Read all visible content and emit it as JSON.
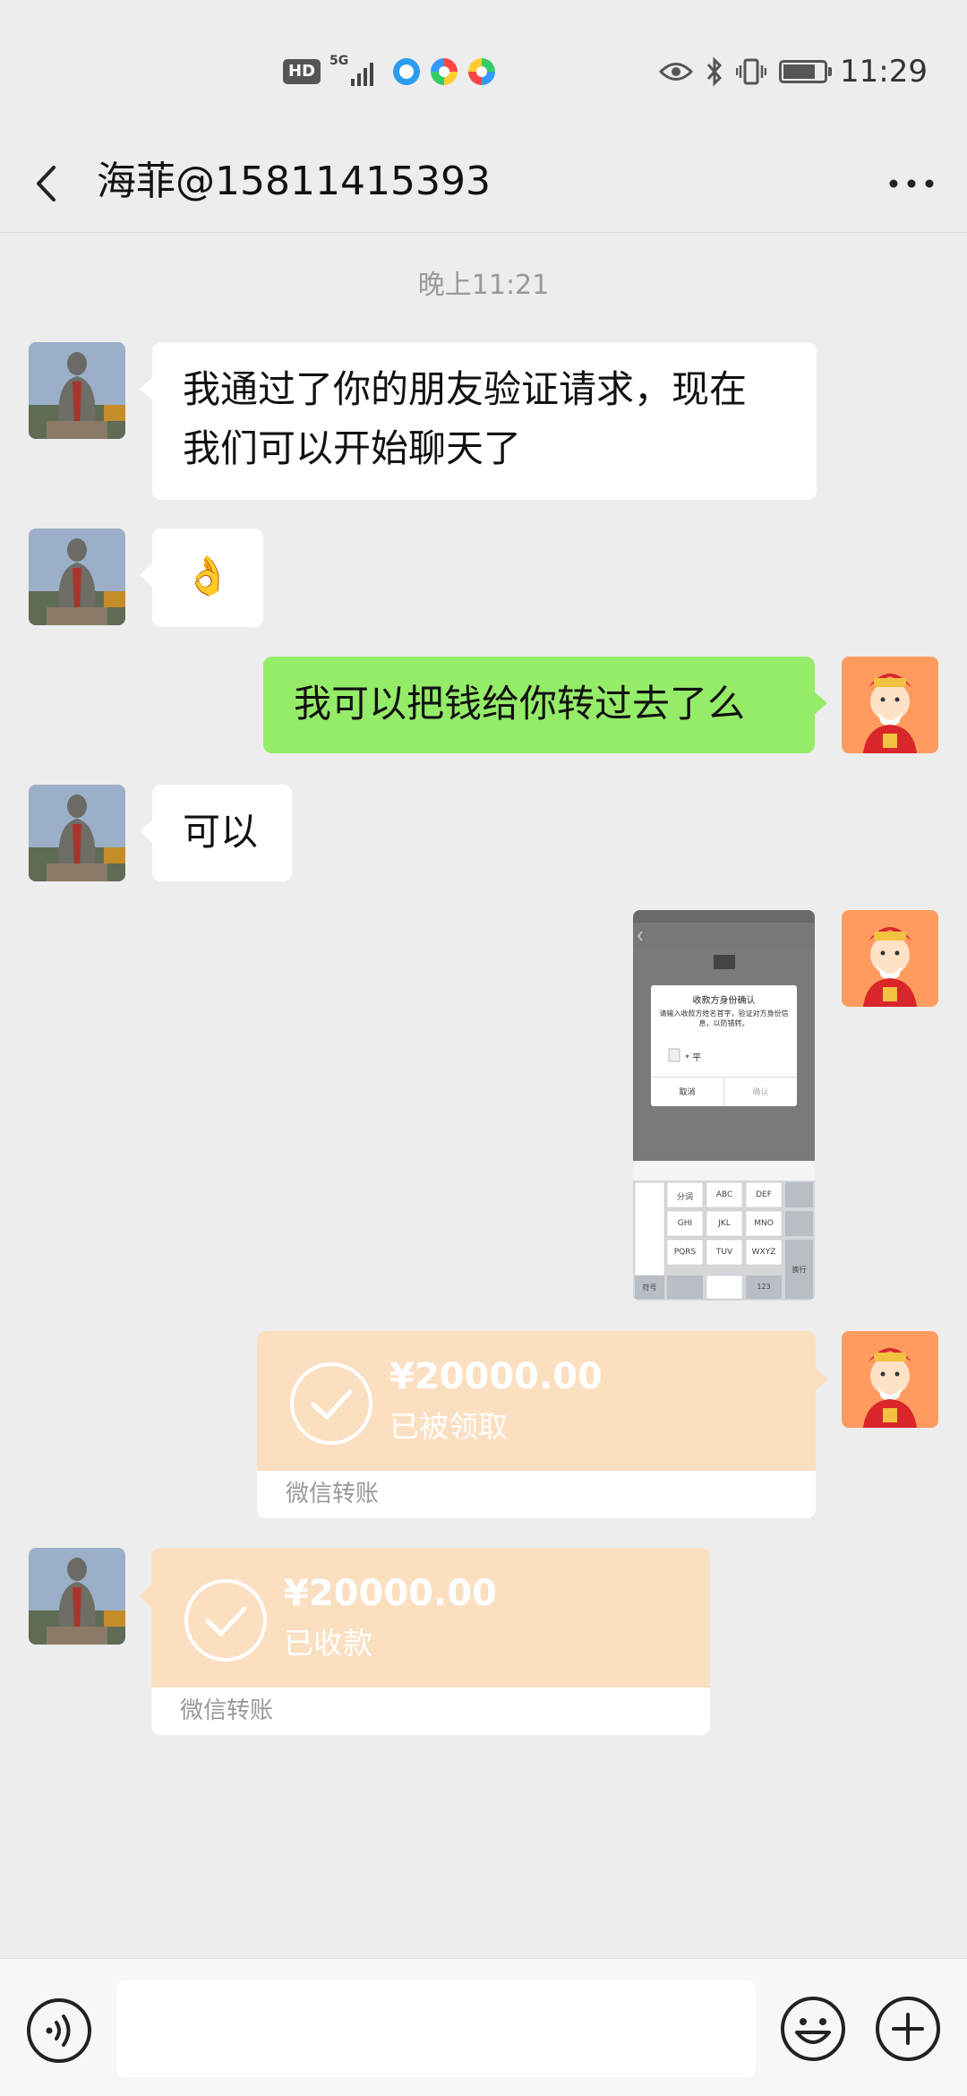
{
  "status_bar": {
    "hd": "HD",
    "network": "5G",
    "time": "11:29",
    "battery_level": 0.72,
    "icons": [
      "hd-icon",
      "signal-icon",
      "app-icon",
      "app-icon",
      "app-icon",
      "eye-icon",
      "bluetooth-icon",
      "vibrate-icon",
      "battery-icon"
    ]
  },
  "header": {
    "title": "海菲@15811415393"
  },
  "chat": {
    "timestamp": "晚上11:21",
    "messages": [
      {
        "side": "left",
        "text_lines": [
          "我通过了你的朋友验证请求，现在",
          "我们可以开始聊天了"
        ]
      },
      {
        "side": "left",
        "emoji": "👌"
      },
      {
        "side": "right",
        "text": "我可以把钱给你转过去了么"
      },
      {
        "side": "left",
        "text": "可以"
      }
    ],
    "screenshot_thumb": {
      "dialog_title": "收款方身份确认",
      "dialog_text": "请输入收款方姓名首字，验证对方身份信息，以防错转。",
      "input_hint": "* 平",
      "cancel": "取消",
      "confirm": "确认",
      "keys": [
        "分词",
        "ABC",
        "DEF",
        "GHI",
        "JKL",
        "MNO",
        "PQRS",
        "TUV",
        "WXYZ",
        "符号",
        "123",
        "换行"
      ]
    },
    "transfer_sent": {
      "amount": "¥20000.00",
      "status": "已被领取",
      "footer": "微信转账"
    },
    "transfer_received": {
      "amount": "¥20000.00",
      "status": "已收款",
      "footer": "微信转账"
    }
  },
  "colors": {
    "background": "#ededed",
    "sent_bubble": "#95ec69",
    "received_bubble": "#ffffff",
    "transfer_card": "#fbdfc1"
  }
}
